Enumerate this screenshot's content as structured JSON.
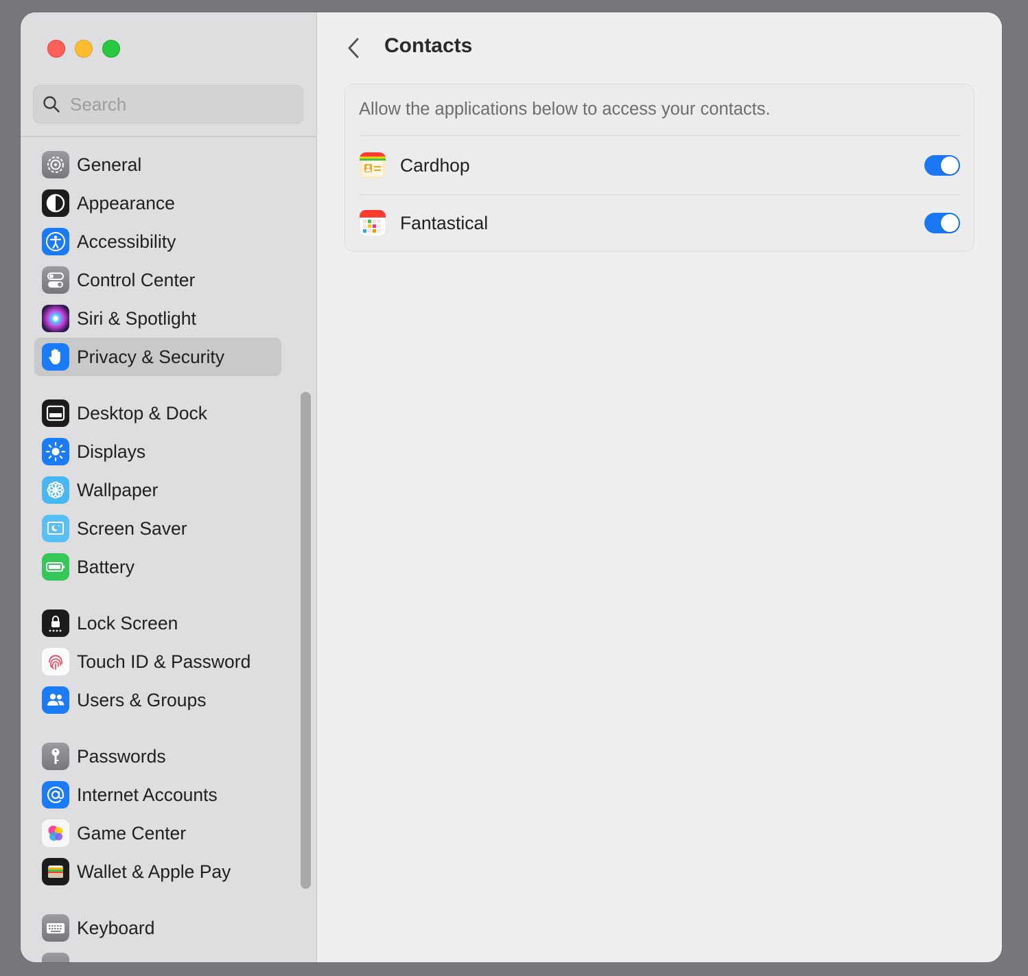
{
  "search": {
    "placeholder": "Search"
  },
  "sidebar": {
    "items": [
      {
        "label": "General",
        "icon": "gear-icon"
      },
      {
        "label": "Appearance",
        "icon": "appearance-icon"
      },
      {
        "label": "Accessibility",
        "icon": "accessibility-icon"
      },
      {
        "label": "Control Center",
        "icon": "control-center-icon"
      },
      {
        "label": "Siri & Spotlight",
        "icon": "siri-icon"
      },
      {
        "label": "Privacy & Security",
        "icon": "hand-icon",
        "selected": true
      },
      {
        "label": "Desktop & Dock",
        "icon": "dock-icon"
      },
      {
        "label": "Displays",
        "icon": "sun-icon"
      },
      {
        "label": "Wallpaper",
        "icon": "flower-icon"
      },
      {
        "label": "Screen Saver",
        "icon": "screen-saver-icon"
      },
      {
        "label": "Battery",
        "icon": "battery-icon"
      },
      {
        "label": "Lock Screen",
        "icon": "lock-icon"
      },
      {
        "label": "Touch ID & Password",
        "icon": "fingerprint-icon"
      },
      {
        "label": "Users & Groups",
        "icon": "users-icon"
      },
      {
        "label": "Passwords",
        "icon": "key-icon"
      },
      {
        "label": "Internet Accounts",
        "icon": "at-icon"
      },
      {
        "label": "Game Center",
        "icon": "game-center-icon"
      },
      {
        "label": "Wallet & Apple Pay",
        "icon": "wallet-icon"
      },
      {
        "label": "Keyboard",
        "icon": "keyboard-icon"
      }
    ]
  },
  "main": {
    "title": "Contacts",
    "description": "Allow the applications below to access your contacts.",
    "apps": [
      {
        "name": "Cardhop",
        "icon": "cardhop-app-icon",
        "enabled": true
      },
      {
        "name": "Fantastical",
        "icon": "fantastical-app-icon",
        "enabled": true
      }
    ]
  },
  "colors": {
    "accent": "#1a78f2",
    "sidebar_bg": "#dedee0",
    "selected_bg": "#c9c9cb"
  }
}
